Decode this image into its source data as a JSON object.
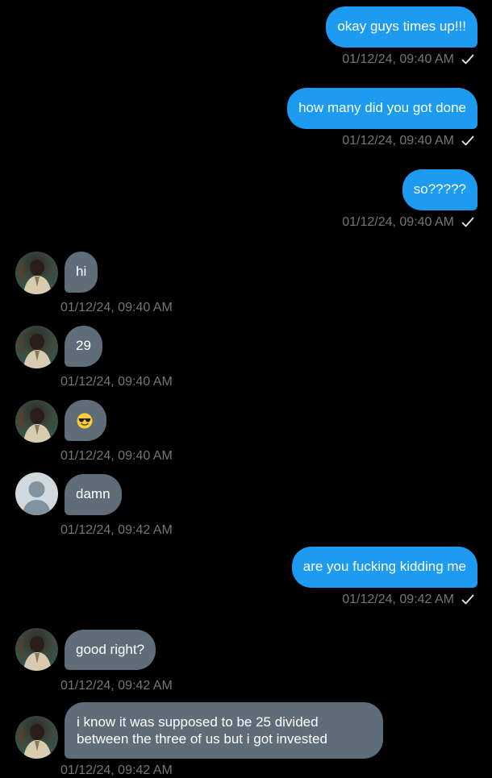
{
  "colors": {
    "background": "#000000",
    "outgoing_bubble": "#1d9bf0",
    "incoming_bubble": "#5f6d79",
    "timestamp": "#71767b"
  },
  "messages": [
    {
      "direction": "out",
      "text": "okay guys times up!!!",
      "time": "01/12/24, 09:40 AM",
      "status_icon": "check-icon"
    },
    {
      "direction": "out",
      "text": "how many did you got done",
      "time": "01/12/24, 09:40 AM",
      "status_icon": "check-icon"
    },
    {
      "direction": "out",
      "text": "so?????",
      "time": "01/12/24, 09:40 AM",
      "status_icon": "check-icon"
    },
    {
      "direction": "in",
      "avatar": "user-photo-avatar",
      "text": "hi",
      "time": "01/12/24, 09:40 AM"
    },
    {
      "direction": "in",
      "avatar": "user-photo-avatar",
      "text": "29",
      "time": "01/12/24, 09:40 AM"
    },
    {
      "direction": "in",
      "avatar": "user-photo-avatar",
      "text": "",
      "emoji": "sunglasses-emoji-icon",
      "time": "01/12/24, 09:40 AM"
    },
    {
      "direction": "in",
      "avatar": "default-avatar",
      "text": "damn",
      "time": "01/12/24, 09:42 AM"
    },
    {
      "direction": "out",
      "text": "are you fucking kidding me",
      "time": "01/12/24, 09:42 AM",
      "status_icon": "check-icon"
    },
    {
      "direction": "in",
      "avatar": "user-photo-avatar",
      "text": "good right?",
      "time": "01/12/24, 09:42 AM"
    },
    {
      "direction": "in",
      "avatar": "user-photo-avatar",
      "text": "i know it was supposed to be 25 divided between the three of us but i got invested",
      "time": "01/12/24, 09:42 AM"
    }
  ]
}
